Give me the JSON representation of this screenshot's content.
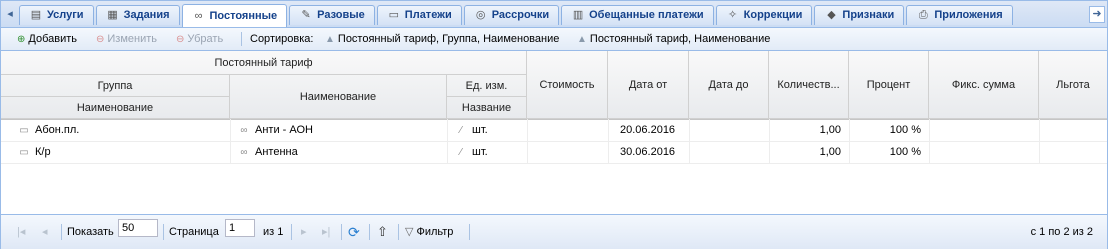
{
  "tabs": [
    {
      "label": "Услуги",
      "icon": "clipboard-icon",
      "glyph": "▤"
    },
    {
      "label": "Задания",
      "icon": "task-list-icon",
      "glyph": "▦"
    },
    {
      "label": "Постоянные",
      "icon": "link-icon",
      "glyph": "∞",
      "active": true
    },
    {
      "label": "Разовые",
      "icon": "wrench-icon",
      "glyph": "✎"
    },
    {
      "label": "Платежи",
      "icon": "card-icon",
      "glyph": "▭"
    },
    {
      "label": "Рассрочки",
      "icon": "lifebuoy-icon",
      "glyph": "◎"
    },
    {
      "label": "Обещанные платежи",
      "icon": "notepad-icon",
      "glyph": "▥"
    },
    {
      "label": "Коррекции",
      "icon": "magic-wand-icon",
      "glyph": "✧"
    },
    {
      "label": "Признаки",
      "icon": "tag-icon",
      "glyph": "◆"
    },
    {
      "label": "Приложения",
      "icon": "attachment-icon",
      "glyph": "⎙"
    }
  ],
  "toolbar": {
    "add": "Добавить",
    "edit": "Изменить",
    "remove": "Убрать",
    "sort_label": "Сортировка:",
    "sort1": "Постоянный тариф, Группа, Наименование",
    "sort2": "Постоянный тариф, Наименование"
  },
  "header": {
    "tariff": "Постоянный тариф",
    "group": "Группа",
    "group_name": "Наименование",
    "name": "Наименование",
    "unit": "Ед. изм.",
    "unit_name": "Название",
    "cost": "Стоимость",
    "date_from": "Дата от",
    "date_to": "Дата до",
    "quantity": "Количеств...",
    "percent": "Процент",
    "fixed_sum": "Фикс. сумма",
    "benefit": "Льгота"
  },
  "rows": [
    {
      "group": "Абон.пл.",
      "name": "Анти - АОН",
      "unit": "шт.",
      "date_from": "20.06.2016",
      "quantity": "1,00",
      "percent": "100 %"
    },
    {
      "group": "К/р",
      "name": "Антенна",
      "unit": "шт.",
      "date_from": "30.06.2016",
      "quantity": "1,00",
      "percent": "100 %"
    }
  ],
  "pager": {
    "show_label": "Показать",
    "page_size": "50",
    "page_label": "Страница",
    "page": "1",
    "of": "из 1",
    "filter": "Фильтр",
    "summary": "с 1 по 2 из 2"
  }
}
